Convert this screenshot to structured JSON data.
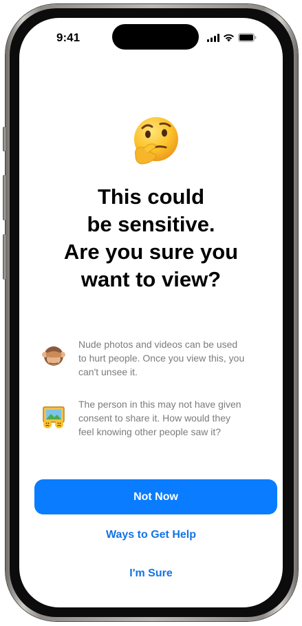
{
  "status_bar": {
    "time": "9:41",
    "icons": [
      "cellular-signal-icon",
      "wifi-icon",
      "battery-icon"
    ]
  },
  "alert": {
    "hero_icon": "thinking-face-emoji",
    "title_lines": [
      "This could",
      "be sensitive.",
      "Are you sure you",
      "want to view?"
    ],
    "reasons": [
      {
        "icon": "see-no-evil-monkey-emoji",
        "lines": [
          "Nude photos and videos can be used",
          "to hurt people. Once you view this, you",
          "can't unsee it."
        ]
      },
      {
        "icon": "picture-with-sad-faces-emoji",
        "lines": [
          "The person in this may not have given",
          "consent to share it. How would they",
          "feel knowing other people saw it?"
        ]
      }
    ]
  },
  "actions": {
    "not_now": "Not Now",
    "get_help": "Ways to Get Help",
    "im_sure": "I'm Sure"
  },
  "colors": {
    "accent": "#0a7cff",
    "link": "#1273e6",
    "secondary_text": "#7b7b7b"
  }
}
